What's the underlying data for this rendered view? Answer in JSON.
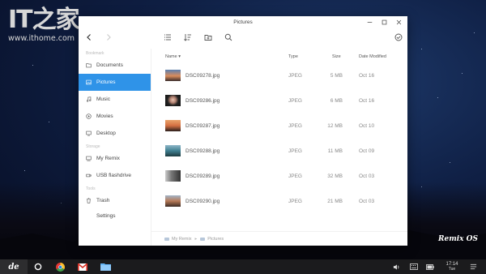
{
  "watermark": {
    "logo": "IT之家",
    "url": "www.ithome.com"
  },
  "remix_logo": "Remix OS",
  "window": {
    "title": "Pictures"
  },
  "icons": {
    "back": "chevron-left-icon",
    "forward": "chevron-right-icon",
    "list_view": "list-view-icon",
    "sort": "sort-icon",
    "new_folder": "new-folder-icon",
    "search": "search-icon",
    "select": "check-circle-icon",
    "minimize": "minimize-icon",
    "maximize": "maximize-icon",
    "close": "close-icon"
  },
  "sidebar": {
    "sections": {
      "bookmark": "Bookmark",
      "storage": "Storage",
      "tools": "Tools"
    },
    "bookmarks": [
      {
        "label": "Documents",
        "icon": "folder-icon"
      },
      {
        "label": "Pictures",
        "icon": "picture-icon",
        "active": true
      },
      {
        "label": "Music",
        "icon": "music-icon"
      },
      {
        "label": "Movies",
        "icon": "movie-icon"
      },
      {
        "label": "Desktop",
        "icon": "desktop-icon"
      }
    ],
    "storage": [
      {
        "label": "My Remix",
        "icon": "computer-icon"
      },
      {
        "label": "USB flashdrive",
        "icon": "usb-icon"
      }
    ],
    "tools": [
      {
        "label": "Trash",
        "icon": "trash-icon"
      },
      {
        "label": "Settings"
      }
    ]
  },
  "columns": {
    "name": "Name",
    "type": "Type",
    "size": "Size",
    "date": "Date Modified"
  },
  "files": [
    {
      "name": "DSC09278.jpg",
      "type": "JPEG",
      "size": "5 MB",
      "date": "Oct 16"
    },
    {
      "name": "DSC09286.jpg",
      "type": "JPEG",
      "size": "6 MB",
      "date": "Oct 16"
    },
    {
      "name": "DSC09287.jpg",
      "type": "JPEG",
      "size": "12 MB",
      "date": "Oct 10"
    },
    {
      "name": "DSC09288.jpg",
      "type": "JPEG",
      "size": "11 MB",
      "date": "Oct 09"
    },
    {
      "name": "DSC09289.jpg",
      "type": "JPEG",
      "size": "32 MB",
      "date": "Oct 03"
    },
    {
      "name": "DSC09290.jpg",
      "type": "JPEG",
      "size": "21 MB",
      "date": "Oct 03"
    }
  ],
  "path": [
    "My Remix",
    "Pictures"
  ],
  "taskbar": {
    "start_label": "de",
    "apps": [
      "home-circle-icon",
      "chrome-icon",
      "gmail-icon",
      "file-manager-icon"
    ],
    "clock": {
      "time": "17:14",
      "day": "Tue"
    }
  },
  "colors": {
    "accent": "#2f93e8",
    "taskbar": "#1b1b1d"
  }
}
